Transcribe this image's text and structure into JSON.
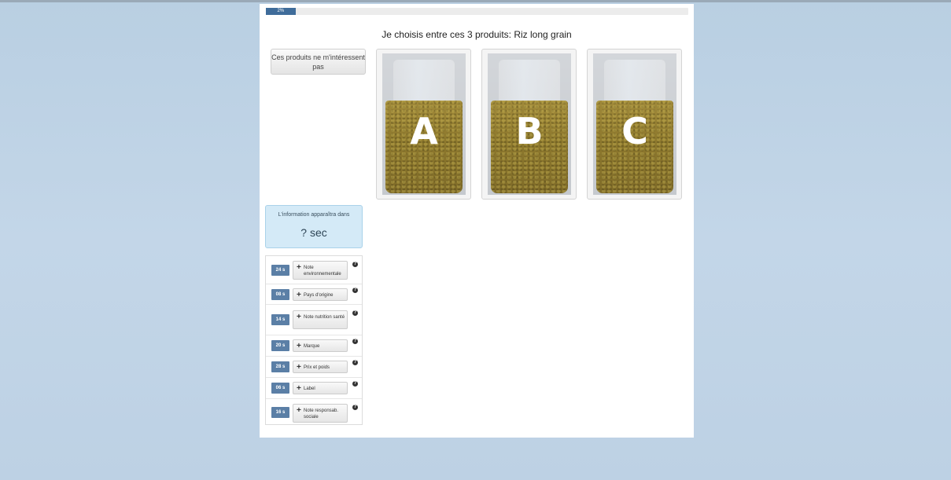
{
  "progress": {
    "label": "2%",
    "value_percent": 7
  },
  "question": {
    "title": "Je choisis entre ces 3 produits: Riz long grain"
  },
  "actions": {
    "no_interest_label": "Ces produits ne m'intéressent pas"
  },
  "products": [
    {
      "letter": "A"
    },
    {
      "letter": "B"
    },
    {
      "letter": "C"
    }
  ],
  "info": {
    "label": "L'information apparaîtra dans",
    "timer": "? sec"
  },
  "attributes": [
    {
      "time": "24 s",
      "label": "Note environnementale"
    },
    {
      "time": "08 s",
      "label": "Pays d'origine"
    },
    {
      "time": "14 s",
      "label": "Note nutrition santé"
    },
    {
      "time": "20 s",
      "label": "Marque"
    },
    {
      "time": "28 s",
      "label": "Prix et poids"
    },
    {
      "time": "06 s",
      "label": "Label"
    },
    {
      "time": "16 s",
      "label": "Note responsab. sociale"
    }
  ],
  "colors": {
    "accent": "#5b7fa6",
    "progress": "#3f6c9a",
    "info_bg": "#d4eaf7",
    "background": "#c0d4e6"
  },
  "icons": {
    "help": "question-circle-icon",
    "plus": "plus-icon"
  }
}
